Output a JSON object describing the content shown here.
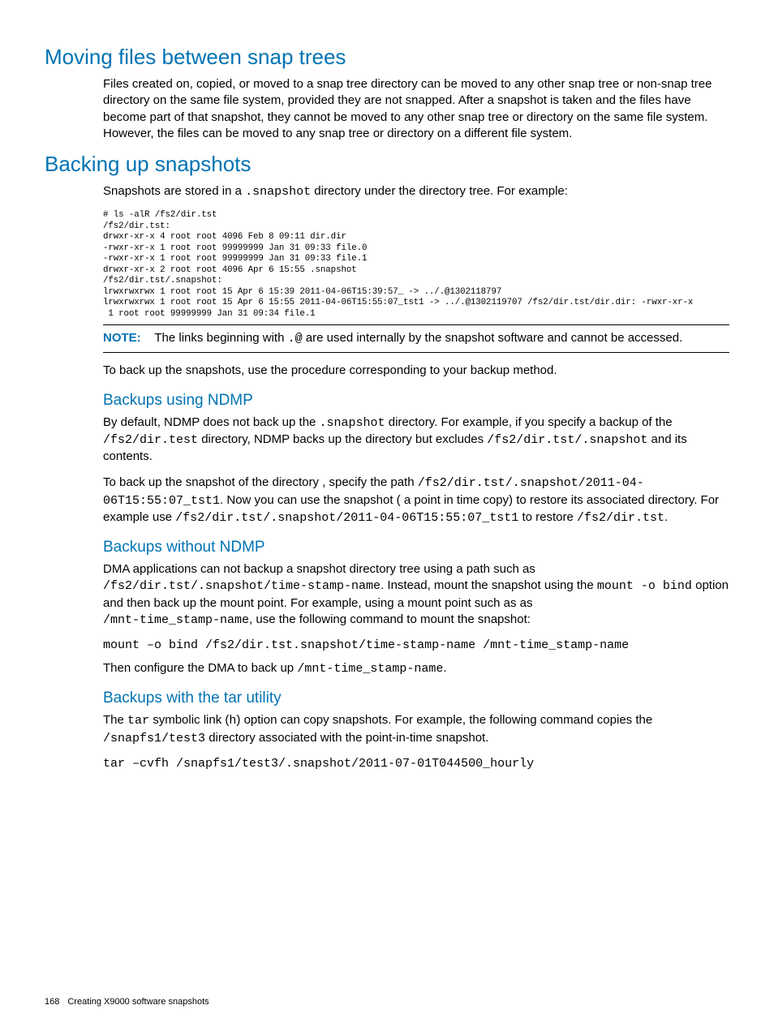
{
  "h1_a": "Moving files between snap trees",
  "p1": "Files created on, copied, or moved to a snap tree directory can be moved to any other snap tree or non-snap tree directory on the same file system, provided they are not snapped. After a snapshot is taken and the files have become part of that snapshot, they cannot be moved to any other snap tree or directory on the same file system. However, the files can be moved to any snap tree or directory on a different file system.",
  "h1_b": "Backing up snapshots",
  "p2a": "Snapshots are stored in a ",
  "p2code": ".snapshot",
  "p2b": " directory under the directory tree. For example:",
  "code1": "# ls -alR /fs2/dir.tst\n/fs2/dir.tst:\ndrwxr-xr-x 4 root root 4096 Feb 8 09:11 dir.dir\n-rwxr-xr-x 1 root root 99999999 Jan 31 09:33 file.0\n-rwxr-xr-x 1 root root 99999999 Jan 31 09:33 file.1\ndrwxr-xr-x 2 root root 4096 Apr 6 15:55 .snapshot\n/fs2/dir.tst/.snapshot:\nlrwxrwxrwx 1 root root 15 Apr 6 15:39 2011-04-06T15:39:57_ -> ../.@1302118797\nlrwxrwxrwx 1 root root 15 Apr 6 15:55 2011-04-06T15:55:07_tst1 -> ../.@1302119707 /fs2/dir.tst/dir.dir: -rwxr-xr-x\n 1 root root 99999999 Jan 31 09:34 file.1",
  "note_label": "NOTE:",
  "note_a": "The links beginning with ",
  "note_code": ".@",
  "note_b": " are used internally by the snapshot software and cannot be accessed.",
  "p3": "To back up the snapshots, use the procedure corresponding to your backup method.",
  "h2_a": "Backups using NDMP",
  "p4a": "By default, NDMP does not back up the ",
  "p4c1": ".snapshot",
  "p4b": " directory. For example, if you specify a backup of the ",
  "p4c2": "/fs2/dir.test",
  "p4c": " directory, NDMP backs up the directory but excludes ",
  "p4c3": "/fs2/dir.tst/.snapshot",
  "p4d": " and its contents.",
  "p5a": "To back up the snapshot of the directory , specify the path ",
  "p5c1": "/fs2/dir.tst/.snapshot/2011-04-06T15:55:07_tst1",
  "p5b": ". Now you can use the snapshot ( a point in time copy) to restore its associated directory. For example use ",
  "p5c2": "/fs2/dir.tst/.snapshot/2011-04-06T15:55:07_tst1",
  "p5c": " to restore ",
  "p5c3": "/fs2/dir.tst",
  "p5d": ".",
  "h2_b": "Backups without NDMP",
  "p6a": "DMA applications can not backup a snapshot directory tree using a path such as ",
  "p6c1": "/fs2/dir.tst/.snapshot/time-stamp-name",
  "p6b": ". Instead, mount the snapshot using the ",
  "p6c2": "mount -o bind",
  "p6c": " option and then back up the mount point. For example, using a mount point such as as ",
  "p6c3": "/mnt-time_stamp-name",
  "p6d": ", use the following command to mount the snapshot:",
  "cmd1": "mount –o bind /fs2/dir.tst.snapshot/time-stamp-name /mnt-time_stamp-name",
  "p7a": "Then configure the DMA to back up ",
  "p7c1": "/mnt-time_stamp-name",
  "p7b": ".",
  "h2_c": "Backups with the tar utility",
  "p8a": "The ",
  "p8c1": "tar",
  "p8b": " symbolic link (",
  "p8c2": "h",
  "p8c": ") option can copy snapshots. For example, the following command copies the ",
  "p8c3": "/snapfs1/test3",
  "p8d": " directory associated with the point-in-time snapshot.",
  "cmd2": "tar –cvfh /snapfs1/test3/.snapshot/2011-07-01T044500_hourly",
  "page_no": "168",
  "footer_text": "Creating X9000 software snapshots"
}
